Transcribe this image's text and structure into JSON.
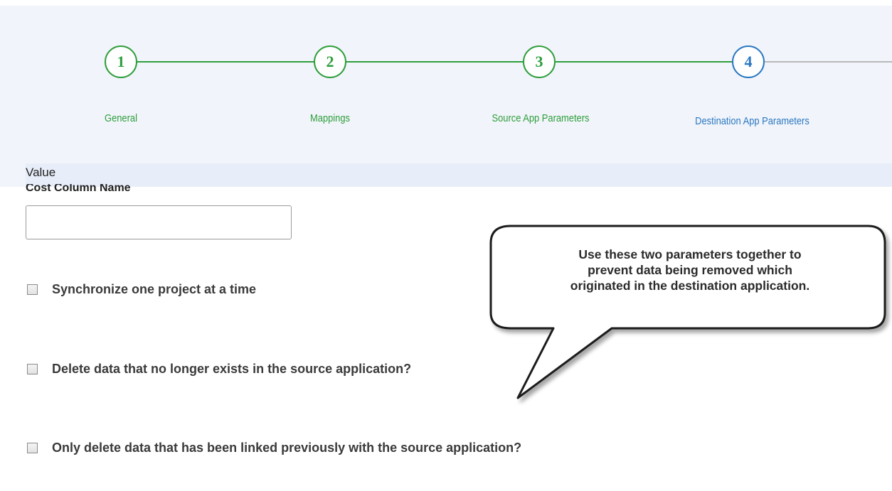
{
  "wizard": {
    "steps": [
      {
        "number": "1",
        "label": "General",
        "state": "complete"
      },
      {
        "number": "2",
        "label": "Mappings",
        "state": "complete"
      },
      {
        "number": "3",
        "label": "Source App Parameters",
        "state": "complete"
      },
      {
        "number": "4",
        "label": "Destination App Parameters",
        "state": "active"
      }
    ],
    "colors": {
      "complete": "#2e9e3c",
      "active": "#2a78c2",
      "pending_line": "#b9b9b9"
    }
  },
  "section": {
    "header": "Value"
  },
  "form": {
    "cost_column": {
      "label": "Cost Column Name",
      "value": ""
    },
    "checkboxes": [
      {
        "label": "Synchronize one project at a time",
        "checked": false
      },
      {
        "label": "Delete data that no longer exists in the source application?",
        "checked": false
      },
      {
        "label": "Only delete data that has been linked previously with the source application?",
        "checked": false
      }
    ]
  },
  "callout": {
    "lines": [
      "Use these two parameters together to",
      "prevent data being removed which",
      "originated in the destination application."
    ]
  }
}
